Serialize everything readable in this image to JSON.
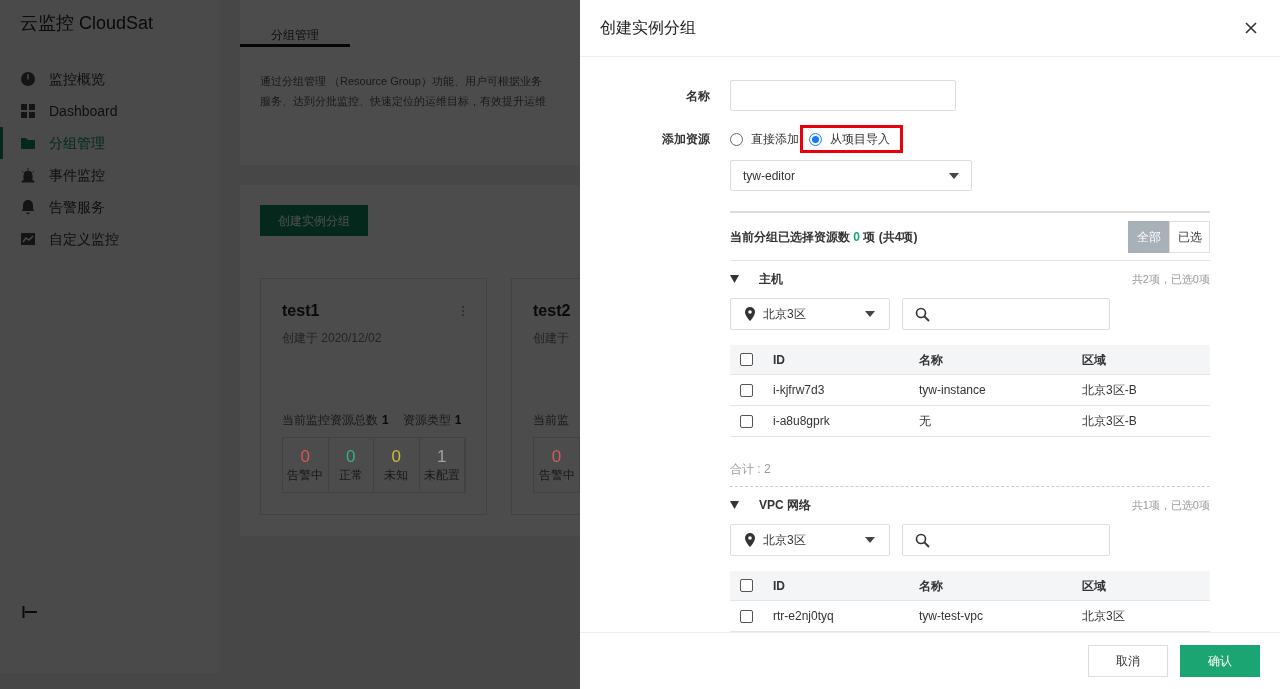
{
  "sidebar": {
    "logo": "云监控 CloudSat",
    "items": [
      {
        "label": "监控概览",
        "selected": false
      },
      {
        "label": "Dashboard",
        "selected": false
      },
      {
        "label": "分组管理",
        "selected": true
      },
      {
        "label": "事件监控",
        "selected": false
      },
      {
        "label": "告警服务",
        "selected": false
      },
      {
        "label": "自定义监控",
        "selected": false
      }
    ]
  },
  "main": {
    "tab": "分组管理",
    "description": [
      "通过分组管理 （Resource Group）功能、用户可根据业务",
      "服务、达到分批监控、快速定位的运维目标，有效提升运维"
    ],
    "create_button": "创建实例分组",
    "cards": [
      {
        "title": "test1",
        "created": "创建于 2020/12/02",
        "total_label": "当前监控资源总数",
        "total": "1",
        "type_label": "资源类型",
        "type": "1",
        "stats": [
          {
            "value": "0",
            "label": "告警中",
            "color": "#d05a5a"
          },
          {
            "value": "0",
            "label": "正常",
            "color": "#35b07e"
          },
          {
            "value": "0",
            "label": "未知",
            "color": "#c8bc3a"
          },
          {
            "value": "1",
            "label": "未配置",
            "color": "#a0a0a0"
          }
        ]
      },
      {
        "title": "test2",
        "created": "创建于",
        "total_label": "当前监",
        "stats": [
          {
            "value": "0",
            "label": "告警中",
            "color": "#d05a5a"
          }
        ]
      }
    ]
  },
  "drawer": {
    "title": "创建实例分组",
    "name_label": "名称",
    "resource_label": "添加资源",
    "radios": [
      {
        "label": "直接添加",
        "selected": false,
        "highlighted": false
      },
      {
        "label": "从项目导入",
        "selected": true,
        "highlighted": true
      }
    ],
    "project": "tyw-editor",
    "summary": {
      "prefix": "当前分组已选择资源数",
      "count": "0",
      "suffix": "项 (共4项)"
    },
    "filters": [
      {
        "label": "全部",
        "selected": true
      },
      {
        "label": "已选",
        "selected": false
      }
    ],
    "groups": [
      {
        "name": "主机",
        "expanded": true,
        "all_checked": false,
        "summary": "共2项，已选0项",
        "region": "北京3区",
        "columns": [
          "ID",
          "名称",
          "区域"
        ],
        "rows": [
          {
            "checked": false,
            "cells": [
              "i-kjfrw7d3",
              "tyw-instance",
              "北京3区-B"
            ]
          },
          {
            "checked": false,
            "cells": [
              "i-a8u8gprk",
              "无",
              "北京3区-B"
            ]
          }
        ],
        "total": "合计 : 2"
      },
      {
        "name": "VPC 网络",
        "expanded": true,
        "all_checked": false,
        "summary": "共1项，已选0项",
        "region": "北京3区",
        "columns": [
          "ID",
          "名称",
          "区域"
        ],
        "rows": [
          {
            "checked": false,
            "cells": [
              "rtr-e2nj0tyq",
              "tyw-test-vpc",
              "北京3区"
            ]
          }
        ]
      }
    ],
    "buttons": [
      {
        "label": "取消",
        "kind": "secondary"
      },
      {
        "label": "确认",
        "kind": "primary"
      }
    ]
  }
}
